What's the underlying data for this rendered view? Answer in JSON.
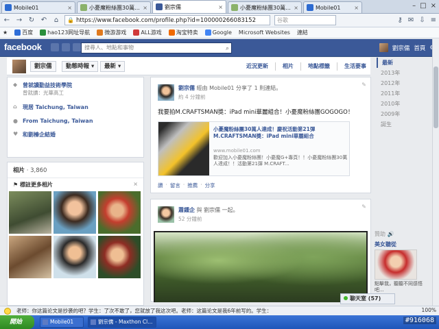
{
  "browser": {
    "tabs": [
      {
        "label": "Mobile01",
        "active": false
      },
      {
        "label": "小憂魔粉絲團30萬...",
        "active": false
      },
      {
        "label": "劉宗儒",
        "active": true
      },
      {
        "label": "小憂魔粉絲團30萬...",
        "active": false
      },
      {
        "label": "Mobile01",
        "active": false
      }
    ],
    "url": "https://www.facebook.com/profile.php?id=100000266083152",
    "search_placeholder": "谷歌",
    "bookmarks": [
      {
        "label": "百度"
      },
      {
        "label": "hao123网址导航"
      },
      {
        "label": "微游游戏"
      },
      {
        "label": "ALL游戏"
      },
      {
        "label": "淘宝特卖"
      },
      {
        "label": "Google"
      },
      {
        "label": "Microsoft Websites"
      },
      {
        "label": "連結"
      }
    ]
  },
  "fb_header": {
    "logo": "facebook",
    "search_placeholder": "搜尋人、地點和事物",
    "user_name": "劉宗儒",
    "home": "首頁"
  },
  "profile_bar": {
    "name": "劉宗儒",
    "menu1": "動態時報",
    "menu2": "最新",
    "tabs": [
      "近況更新",
      "相片",
      "地點標籤",
      "生活要事"
    ]
  },
  "about": {
    "school": "曾就讀勤益技術學院",
    "school_sub": "曾就讀：光華高工",
    "lives": "現居 Taichung, Taiwan",
    "from": "From Taichung, Taiwan",
    "relationship": "和劉榛企結婚"
  },
  "photos": {
    "title": "相片",
    "count": "3,860",
    "tag_more": "標註更多相片"
  },
  "posts": [
    {
      "author": "劉宗儒",
      "via": "經由 Mobile01 分享了 1 則連結。",
      "time": "約 4 分鐘前",
      "text": "我要拍M.CRAFTSMAN獎：iPad mini華麗組合！小憂魔粉絲團GOGOGO！",
      "share_title": "小憂魔粉絲團30萬人達成！慶祝活動第21彈 M.CRAFTSMAN獎：iPad mini華麗組合",
      "share_url": "www.mobile01.com",
      "share_desc": "歡迎加入小憂魔粉絲團！小憂魔G+專頁！！小憂魔粉絲團30萬人達成！！活動第21彈 M.CRAFT...",
      "actions": [
        "讚",
        "留言",
        "推薦",
        "分享"
      ]
    },
    {
      "author": "蕭鍾企",
      "with": "與 劉宗儒 一起。",
      "time": "52 分鐘前"
    }
  ],
  "years": [
    "最新",
    "2013年",
    "2012年",
    "2011年",
    "2010年",
    "2009年",
    "誕生"
  ],
  "ads": {
    "label": "贊助",
    "title": "美女聽從",
    "text": "點擊我，聽聽不同感悟吧..."
  },
  "chat": {
    "label": "聊天室 (57)"
  },
  "status_bar": {
    "text": "老师：你这篇论文是抄袭的吧？学生：了次不敢了，您就放了我这次吧。老师：这篇论文是我6年前写的。学生：",
    "zoom": "100%"
  },
  "taskbar": {
    "start": "開始",
    "tasks": [
      "劉宗儒 - Maxthon Cl...",
      "Mobile01"
    ],
    "watermark": "#916068"
  }
}
